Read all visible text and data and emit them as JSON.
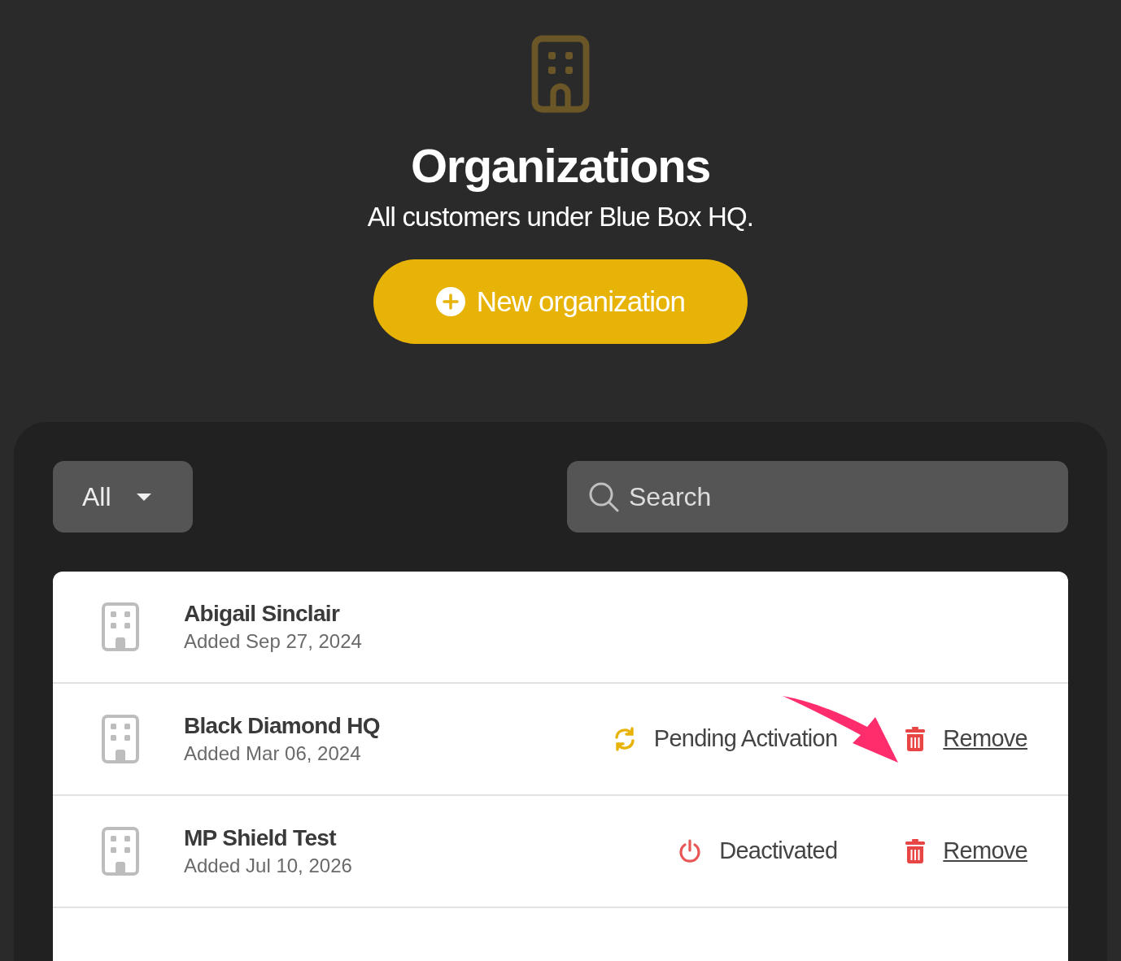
{
  "header": {
    "title": "Organizations",
    "subtitle": "All customers under Blue Box HQ.",
    "new_button": "New organization"
  },
  "filter": {
    "value": "All"
  },
  "search": {
    "placeholder": "Search"
  },
  "organizations": [
    {
      "name": "Abigail Sinclair",
      "added": "Added Sep 27, 2024"
    },
    {
      "name": "Black Diamond HQ",
      "added": "Added Mar 06, 2024",
      "status": {
        "kind": "pending",
        "label": "Pending Activation"
      },
      "action": "Remove"
    },
    {
      "name": "MP Shield Test",
      "added": "Added Jul 10, 2026",
      "status": {
        "kind": "deactivated",
        "label": "Deactivated"
      },
      "action": "Remove"
    }
  ]
}
